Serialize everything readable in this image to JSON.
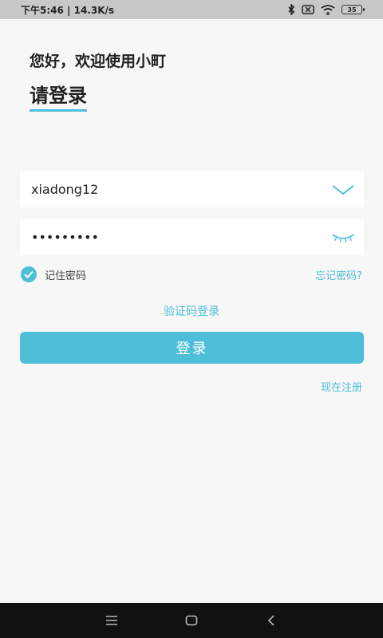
{
  "status_bar": {
    "time": "下午5:46",
    "network_speed": "14.3K/s",
    "battery": "35"
  },
  "header": {
    "greeting": "您好，欢迎使用小町",
    "title": "请登录"
  },
  "form": {
    "username_value": "xiadong12",
    "password_value": "•••••••••",
    "remember_label": "记住密码",
    "remember_checked": true,
    "forgot_label": "忘记密码?",
    "code_login_label": "验证码登录",
    "login_button_label": "登录",
    "register_label": "现在注册"
  },
  "colors": {
    "accent": "#4dbfd8",
    "background": "#f7f7f7"
  },
  "icons": {
    "username_dropdown": "chevron-down-icon",
    "password_toggle": "eye-closed-icon",
    "remember": "check-circle-icon",
    "nav": [
      "menu-icon",
      "home-icon",
      "back-icon"
    ]
  }
}
